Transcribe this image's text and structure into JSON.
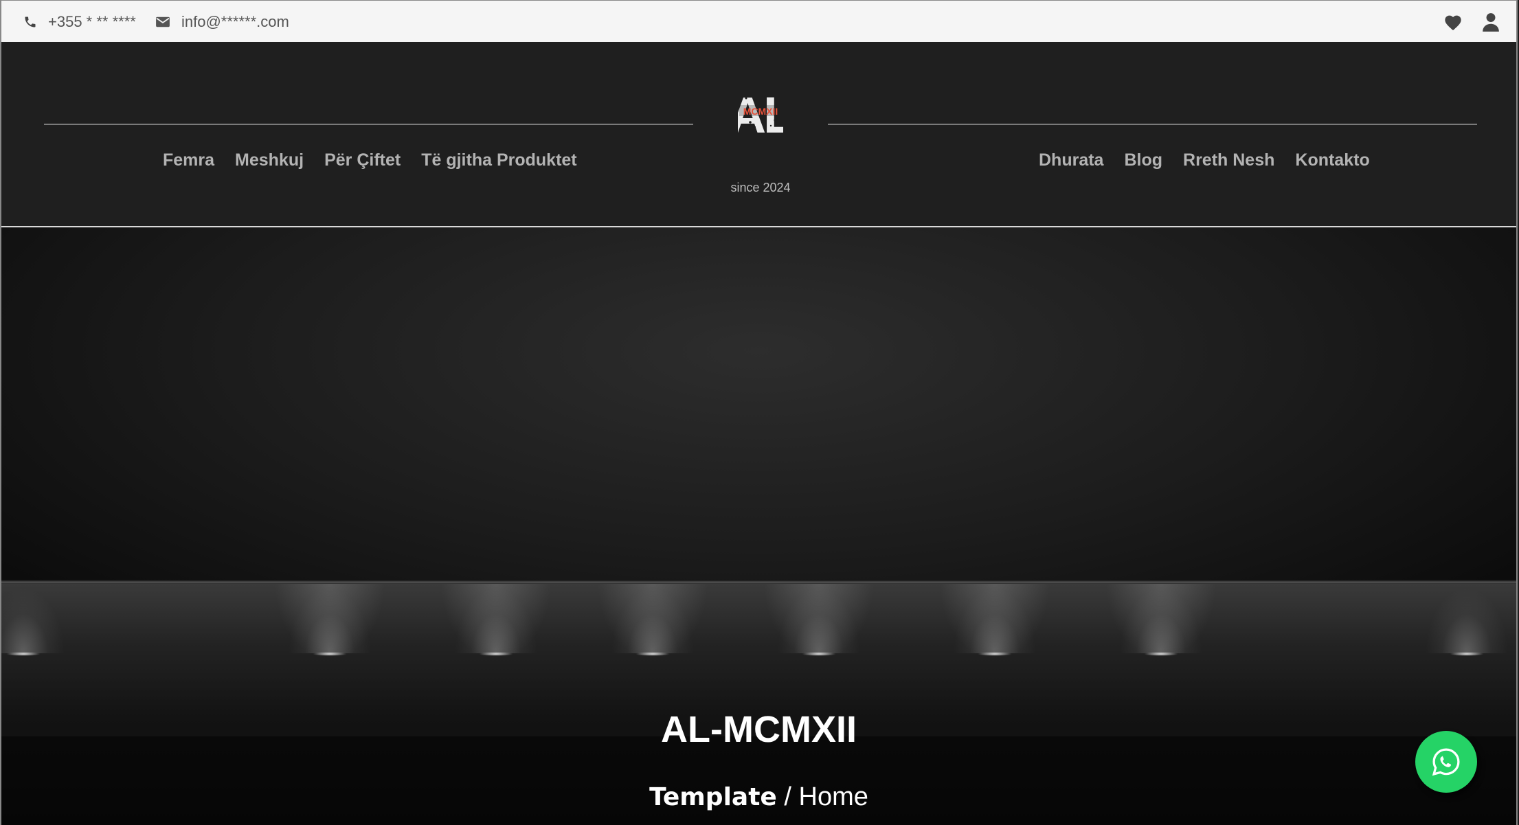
{
  "topbar": {
    "phone": "+355 * ** ****",
    "email": "info@******.com"
  },
  "header": {
    "nav_left": [
      "Femra",
      "Meshkuj",
      "Për Çiftet",
      "Të gjitha Produktet"
    ],
    "nav_right": [
      "Dhurata",
      "Blog",
      "Rreth Nesh",
      "Kontakto"
    ],
    "logo_top": "AL",
    "logo_mid": "MCMXII",
    "since": "since 2024"
  },
  "hero": {
    "title": "AL-MCMXII",
    "breadcrumb_current": "Template",
    "breadcrumb_sep": " / ",
    "breadcrumb_home": "Home"
  },
  "colors": {
    "whatsapp": "#25d366",
    "logo_accent": "#e8523a"
  }
}
